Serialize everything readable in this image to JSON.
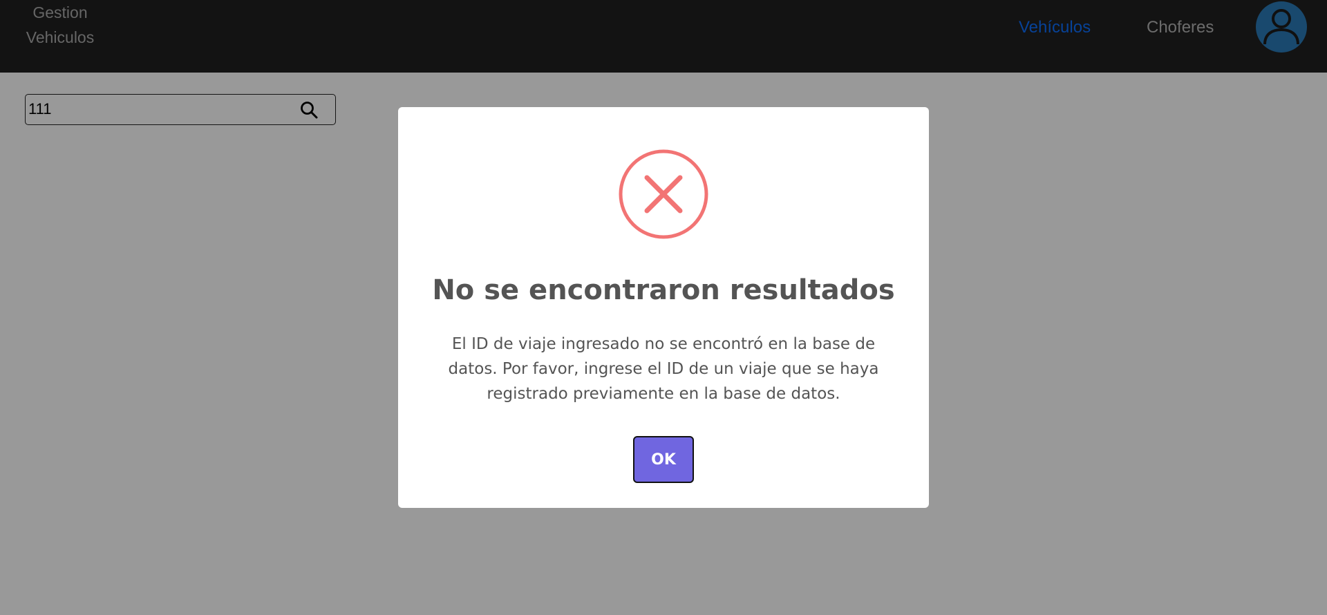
{
  "navbar": {
    "brand_line1": "Gestion",
    "brand_line2": "Vehiculos",
    "links": [
      {
        "label": "Vehículos",
        "active": true
      },
      {
        "label": "Choferes",
        "active": false
      }
    ],
    "avatar_icon": "user-avatar-icon"
  },
  "search": {
    "value": "111",
    "icon": "search-icon"
  },
  "modal": {
    "icon": "error-x-icon",
    "title": "No se encontraron resultados",
    "text": "El ID de viaje ingresado no se encontró en la base de datos. Por favor, ingrese el ID de un viaje que se haya registrado previamente en la base de datos.",
    "ok_label": "OK"
  },
  "colors": {
    "navbar_bg": "#202020",
    "active_link": "#0d6efd",
    "avatar_bg": "#2b7ab7",
    "error_red": "#f27474",
    "ok_button": "#7066e0"
  }
}
